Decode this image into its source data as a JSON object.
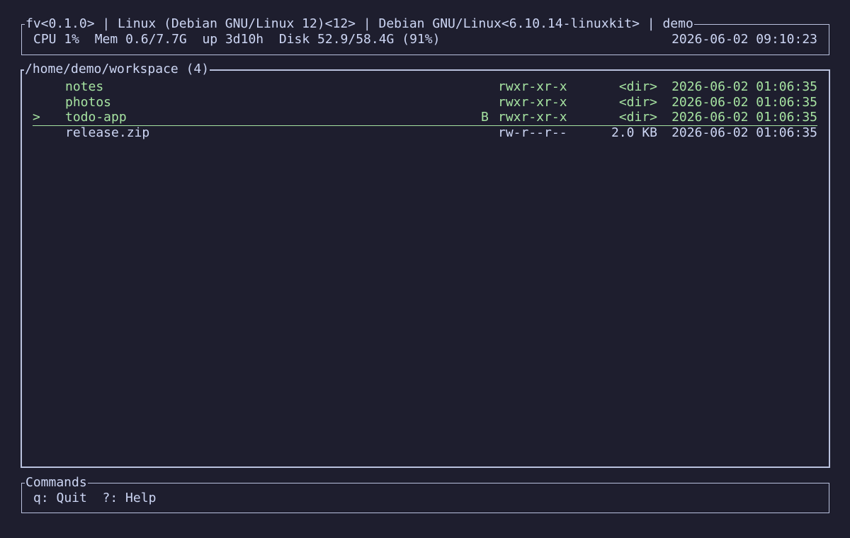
{
  "status": {
    "title": "fv<0.1.0> | Linux (Debian GNU/Linux 12)<12> | Debian GNU/Linux<6.10.14-linuxkit> | demo",
    "cpu": "CPU 1%",
    "mem": "Mem 0.6/7.7G",
    "uptime": "up 3d10h",
    "disk": "Disk 52.9/58.4G (91%)",
    "clock": "2026-06-02 09:10:23"
  },
  "files": {
    "title": "/home/demo/workspace (4)",
    "cursor_glyph": ">",
    "rows": [
      {
        "name": "notes",
        "flag": "",
        "perm": "rwxr-xr-x",
        "size": "<dir>",
        "date": "2026-06-02 01:06:35"
      },
      {
        "name": "photos",
        "flag": "",
        "perm": "rwxr-xr-x",
        "size": "<dir>",
        "date": "2026-06-02 01:06:35"
      },
      {
        "name": "todo-app",
        "flag": "B",
        "perm": "rwxr-xr-x",
        "size": "<dir>",
        "date": "2026-06-02 01:06:35"
      },
      {
        "name": "release.zip",
        "flag": "",
        "perm": "rw-r--r--",
        "size": "2.0 KB",
        "date": "2026-06-02 01:06:35"
      }
    ]
  },
  "commands": {
    "title": "Commands",
    "quit": "q: Quit",
    "help": "?: Help"
  },
  "colors": {
    "background": "#1e1e2e",
    "directory": "#a6e3a1",
    "text": "#cdd6f4",
    "border": "#bac2de"
  }
}
